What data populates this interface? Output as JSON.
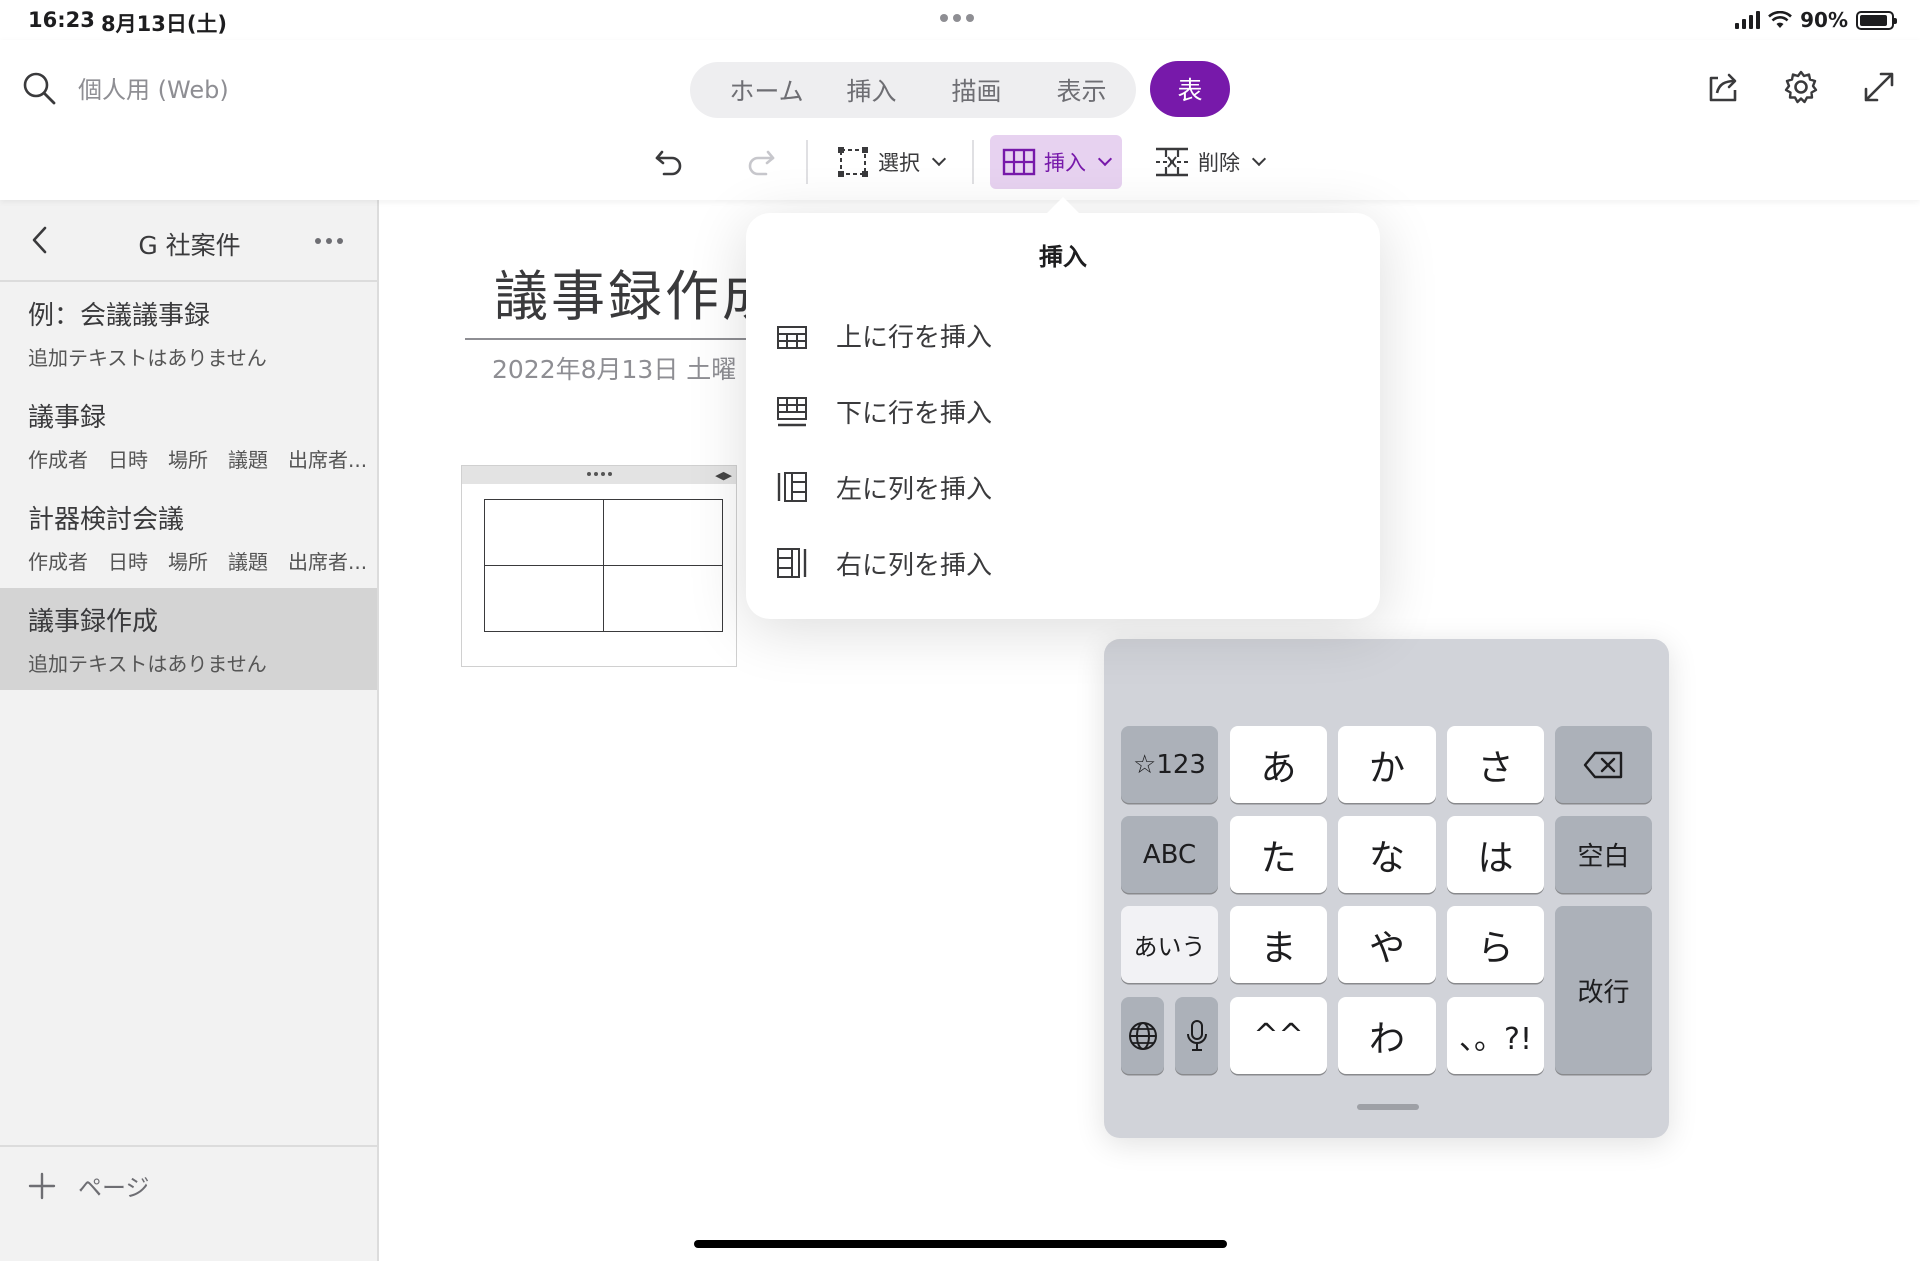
{
  "status_bar": {
    "time": "16:23",
    "date": "8月13日(土)",
    "battery": "90%"
  },
  "search": {
    "label": "個人用 (Web)"
  },
  "tabs": [
    {
      "label": "ホーム"
    },
    {
      "label": "挿入"
    },
    {
      "label": "描画"
    },
    {
      "label": "表示"
    }
  ],
  "active_tab": {
    "label": "表"
  },
  "toolbar": {
    "select_label": "選択",
    "insert_label": "挿入",
    "delete_label": "削除"
  },
  "sidebar": {
    "section_title": "G 社案件",
    "pages": [
      {
        "title": "例：会議議事録",
        "subtitle": "追加テキストはありません"
      },
      {
        "title": "議事録",
        "subtitle": "作成者　日時　場所　議題　出席者..."
      },
      {
        "title": "計器検討会議",
        "subtitle": "作成者　日時　場所　議題　出席者..."
      },
      {
        "title": "議事録作成",
        "subtitle": "追加テキストはありません"
      }
    ],
    "add_page_label": "ページ"
  },
  "page": {
    "title": "議事録作成",
    "date": "2022年8月13日 土曜"
  },
  "popover": {
    "title": "挿入",
    "items": [
      {
        "label": "上に行を挿入",
        "icon": "insert-row-above-icon"
      },
      {
        "label": "下に行を挿入",
        "icon": "insert-row-below-icon"
      },
      {
        "label": "左に列を挿入",
        "icon": "insert-column-left-icon"
      },
      {
        "label": "右に列を挿入",
        "icon": "insert-column-right-icon"
      }
    ]
  },
  "keyboard": {
    "keys": {
      "num": "☆123",
      "a": "あ",
      "ka": "か",
      "sa": "さ",
      "abc": "ABC",
      "ta": "た",
      "na": "な",
      "ha": "は",
      "space": "空白",
      "aiu": "あいう",
      "ma": "ま",
      "ya": "や",
      "ra": "ら",
      "enter": "改行",
      "kaomoji": "^^",
      "wa": "わ",
      "punct": "、。?!"
    }
  },
  "colors": {
    "accent": "#7719aa",
    "accent_light": "#e7d2f0",
    "sidebar_bg": "#f2f2f2",
    "selected_page_bg": "#d4d4d4",
    "keyboard_bg": "#d1d3d9"
  }
}
